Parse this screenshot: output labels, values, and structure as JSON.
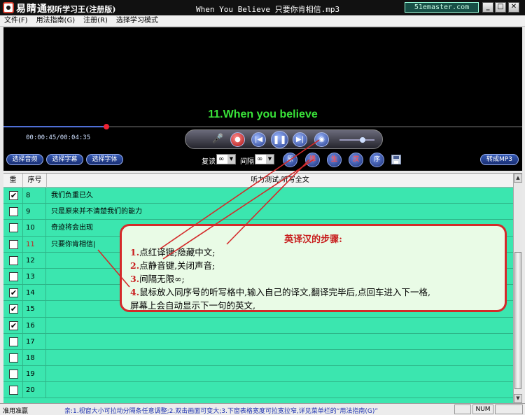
{
  "titlebar": {
    "app_name": "易睛通",
    "app_subtitle": "视听学习王(注册版)",
    "window_title": "When You Believe 只要你肯相信.mp3",
    "brand": "51emaster.com",
    "minimize": "_",
    "maximize": "□",
    "close": "✕"
  },
  "menu": [
    "文件(F)",
    "用法指南(G)",
    "注册(R)",
    "选择学习模式"
  ],
  "video": {
    "subtitle": "11.When you believe"
  },
  "player": {
    "time": "00:00:45/00:04:35",
    "progress_fraction": 0.198,
    "volume_fraction": 0.65,
    "buttons": {
      "mic": "🎤",
      "record": "●",
      "prev": "|◀",
      "pause": "❚❚",
      "next": "▶|",
      "mute": "◉"
    }
  },
  "toolbar": {
    "select_audio": "选择音频",
    "select_subtitle": "选择字幕",
    "select_font": "选择字体",
    "repeat_label": "复读",
    "repeat_value": "∞",
    "interval_label": "间隔",
    "interval_value": "∞",
    "btn_original": "原",
    "btn_translate": "译",
    "btn_sound": "生",
    "btn_chinese": "汉",
    "btn_order": "序",
    "to_mp3": "转成MP3"
  },
  "table": {
    "columns": [
      "重",
      "序号",
      "听力测试-听写全文"
    ],
    "rows": [
      {
        "checked": true,
        "num": "8",
        "text": "我们负重已久",
        "highlight": false
      },
      {
        "checked": false,
        "num": "9",
        "text": "只是原来并不清楚我们的能力",
        "highlight": false
      },
      {
        "checked": false,
        "num": "10",
        "text": "奇迹将会出现",
        "highlight": false
      },
      {
        "checked": false,
        "num": "11",
        "text": "只要你肯相信|",
        "highlight": true
      },
      {
        "checked": false,
        "num": "12",
        "text": "",
        "highlight": false
      },
      {
        "checked": false,
        "num": "13",
        "text": "",
        "highlight": false
      },
      {
        "checked": true,
        "num": "14",
        "text": "",
        "highlight": false
      },
      {
        "checked": true,
        "num": "15",
        "text": "",
        "highlight": false
      },
      {
        "checked": true,
        "num": "16",
        "text": "",
        "highlight": false
      },
      {
        "checked": false,
        "num": "17",
        "text": "",
        "highlight": false
      },
      {
        "checked": false,
        "num": "18",
        "text": "",
        "highlight": false
      },
      {
        "checked": false,
        "num": "19",
        "text": "",
        "highlight": false
      },
      {
        "checked": false,
        "num": "20",
        "text": "",
        "highlight": false
      }
    ]
  },
  "callout": {
    "title": "英译汉的步骤:",
    "steps": [
      {
        "num": "1.",
        "text": "点红译键;隐藏中文;"
      },
      {
        "num": "2.",
        "text": "点静音键,关闭声音;"
      },
      {
        "num": "3.",
        "text": "间隔无限∞;"
      },
      {
        "num": "4.",
        "text": "鼠标放入同序号的听写格中,输入自己的译文,翻译完毕后,点回车进入下一格,",
        "cont": "屏幕上会自动显示下一句的英文,"
      }
    ]
  },
  "status": {
    "left": "准用准赢",
    "message": "亲:1.视窗大小可拉动分隔条任意调整;2.双击画面可变大;3.下窗表格宽度可拉宽拉窄,详见菜单栏的“用法指南(G)”",
    "num": "NUM"
  },
  "colors": {
    "table_bg": "#3be6af",
    "subtitle": "#39e339",
    "callout_border": "#d42a2a"
  }
}
